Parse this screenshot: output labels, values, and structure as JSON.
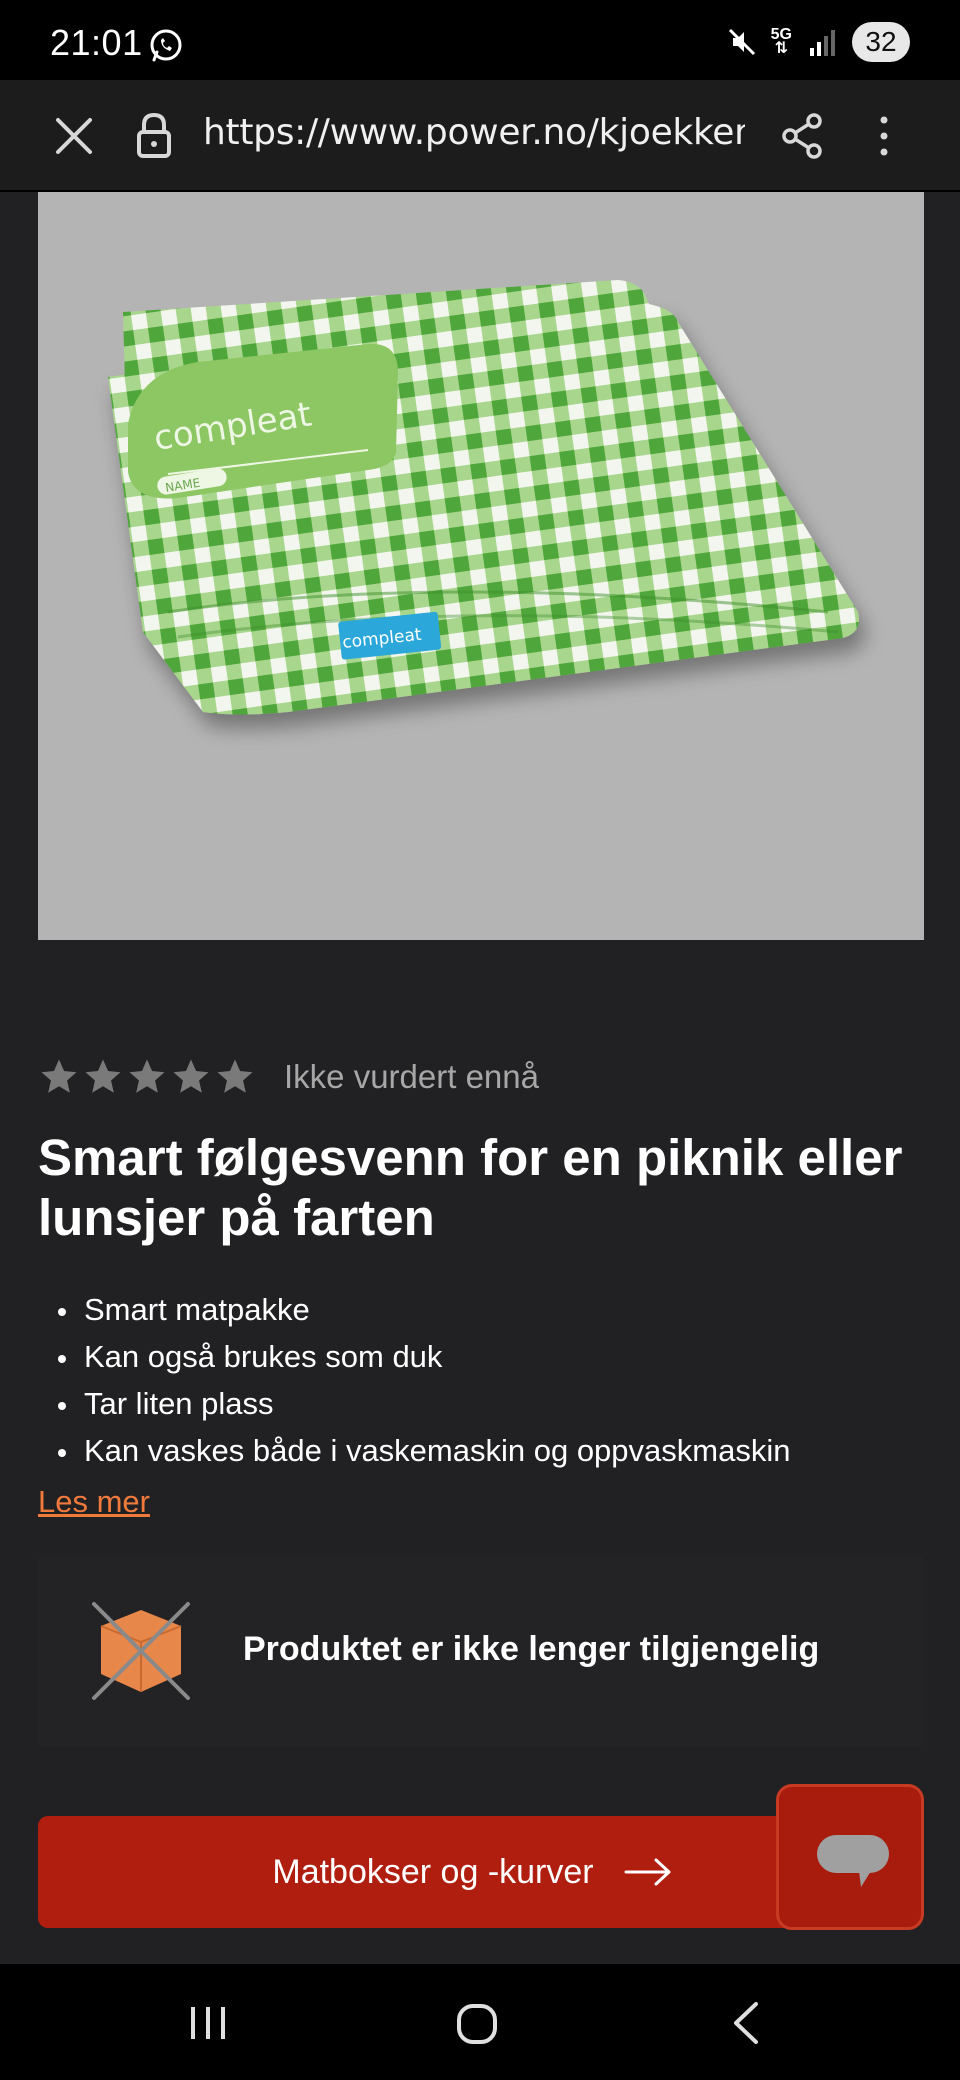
{
  "status_bar": {
    "time": "21:01",
    "battery": "32",
    "network": "5G"
  },
  "browser": {
    "url": "https://www.power.no/kjoekkenı"
  },
  "product": {
    "image_brand_text": "compleat",
    "image_label_text": "NAME",
    "rating_text": "Ikke vurdert ennå",
    "stars_filled": 0,
    "stars_total": 5,
    "headline": "Smart følgesvenn for en piknik eller lunsjer på farten",
    "features": [
      "Smart matpakke",
      "Kan også brukes som duk",
      "Tar liten plass",
      "Kan vaskes både i vaskemaskin og oppvaskmaskin"
    ],
    "read_more": "Les mer",
    "availability_text": "Produktet er ikke lenger tilgjengelig"
  },
  "cta": {
    "label": "Matbokser og -kurver"
  },
  "colors": {
    "accent_orange": "#f07a3c",
    "button_red": "#b01e0f",
    "background": "#212123"
  },
  "icons": {
    "status": [
      "whatsapp-icon",
      "mute-icon",
      "signal-icon",
      "battery-icon"
    ],
    "browser": [
      "close-icon",
      "lock-icon",
      "share-icon",
      "more-vert-icon"
    ],
    "nav": [
      "recents-icon",
      "home-icon",
      "back-icon"
    ]
  }
}
